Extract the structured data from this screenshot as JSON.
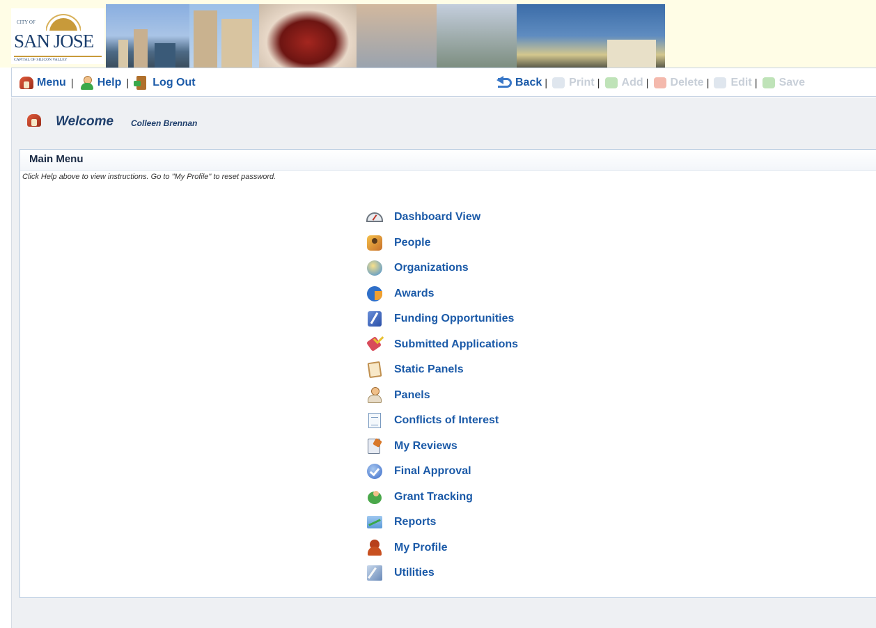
{
  "header": {
    "logo_city_of": "CITY OF",
    "logo_name": "SAN JOSE",
    "logo_tagline": "CAPITAL OF SILICON VALLEY"
  },
  "toolbar": {
    "menu_label": "Menu",
    "help_label": "Help",
    "logout_label": "Log Out",
    "back_label": "Back",
    "print_label": "Print",
    "add_label": "Add",
    "delete_label": "Delete",
    "edit_label": "Edit",
    "save_label": "Save",
    "separator": "|"
  },
  "welcome": {
    "title": "Welcome",
    "user": "Colleen Brennan"
  },
  "main": {
    "title": "Main Menu",
    "hint": "Click Help above to view instructions. Go to \"My Profile\" to reset password.",
    "items": [
      {
        "label": "Dashboard View",
        "icon": "gauge-icon"
      },
      {
        "label": "People",
        "icon": "people-icon"
      },
      {
        "label": "Organizations",
        "icon": "globe-icon"
      },
      {
        "label": "Awards",
        "icon": "pie-icon"
      },
      {
        "label": "Funding Opportunities",
        "icon": "pen-document-icon"
      },
      {
        "label": "Submitted Applications",
        "icon": "pencil-check-icon"
      },
      {
        "label": "Static Panels",
        "icon": "clipboard-icon"
      },
      {
        "label": "Panels",
        "icon": "person-icon"
      },
      {
        "label": "Conflicts of Interest",
        "icon": "document-icon"
      },
      {
        "label": "My Reviews",
        "icon": "notepad-icon"
      },
      {
        "label": "Final Approval",
        "icon": "checkmark-icon"
      },
      {
        "label": "Grant Tracking",
        "icon": "user-group-icon"
      },
      {
        "label": "Reports",
        "icon": "chart-icon"
      },
      {
        "label": "My Profile",
        "icon": "user-icon"
      },
      {
        "label": "Utilities",
        "icon": "tools-icon"
      }
    ]
  },
  "colors": {
    "link": "#1b5aa8",
    "disabled": "#c8cfd8",
    "title": "#1f3f6c"
  }
}
